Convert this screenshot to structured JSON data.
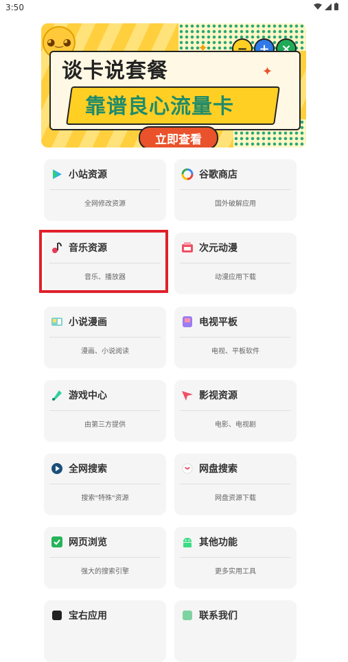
{
  "status": {
    "time": "3:50"
  },
  "banner": {
    "headline": "谈卡说套餐",
    "subline": "靠谱良心流量卡",
    "cta": "立即查看"
  },
  "cards": [
    {
      "title": "小站资源",
      "sub": "全网修改资源",
      "icon": "play-icon"
    },
    {
      "title": "谷歌商店",
      "sub": "国外破解应用",
      "icon": "google-icon"
    },
    {
      "title": "音乐资源",
      "sub": "音乐、播放器",
      "icon": "music-icon"
    },
    {
      "title": "次元动漫",
      "sub": "动漫应用下载",
      "icon": "anime-icon"
    },
    {
      "title": "小说漫画",
      "sub": "漫画、小说阅读",
      "icon": "book-icon"
    },
    {
      "title": "电视平板",
      "sub": "电视、平板软件",
      "icon": "tv-icon"
    },
    {
      "title": "游戏中心",
      "sub": "由第三方提供",
      "icon": "game-icon"
    },
    {
      "title": "影视资源",
      "sub": "电影、电视剧",
      "icon": "video-icon"
    },
    {
      "title": "全网搜索",
      "sub": "搜索\"特殊\"资源",
      "icon": "search-icon"
    },
    {
      "title": "网盘搜索",
      "sub": "网盘资源下载",
      "icon": "cloud-icon"
    },
    {
      "title": "网页浏览",
      "sub": "强大的搜索引擎",
      "icon": "shield-icon"
    },
    {
      "title": "其他功能",
      "sub": "更多实用工具",
      "icon": "android-icon"
    },
    {
      "title": "宝右应用",
      "sub": "",
      "icon": "app-icon"
    },
    {
      "title": "联系我们",
      "sub": "",
      "icon": "contact-icon"
    }
  ]
}
